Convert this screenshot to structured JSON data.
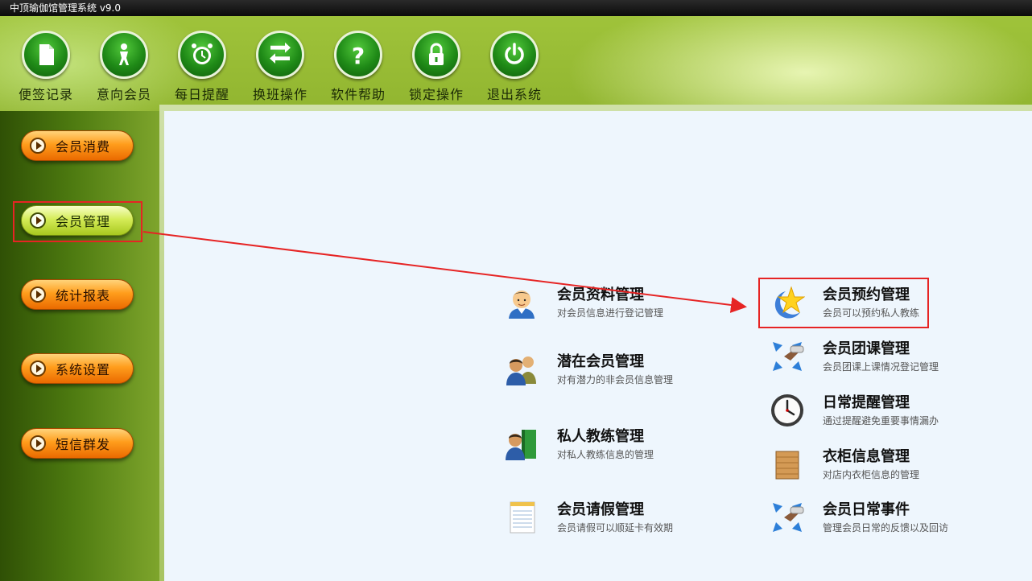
{
  "window": {
    "title": "中顶瑜伽馆管理系统  v9.0"
  },
  "toolbar": [
    {
      "label": "便签记录",
      "icon": "notepad-icon"
    },
    {
      "label": "意向会员",
      "icon": "person-icon"
    },
    {
      "label": "每日提醒",
      "icon": "alarm-clock-icon"
    },
    {
      "label": "换班操作",
      "icon": "swap-arrows-icon"
    },
    {
      "label": "软件帮助",
      "icon": "question-icon"
    },
    {
      "label": "锁定操作",
      "icon": "lock-icon"
    },
    {
      "label": "退出系统",
      "icon": "power-icon"
    }
  ],
  "sidebar": {
    "items": [
      {
        "label": "会员消费"
      },
      {
        "label": "会员管理",
        "active": true
      },
      {
        "label": "统计报表"
      },
      {
        "label": "系统设置"
      },
      {
        "label": "短信群发"
      }
    ]
  },
  "functions": {
    "left": [
      {
        "title": "会员资料管理",
        "desc": "对会员信息进行登记管理",
        "icon": "member-avatar-icon"
      },
      {
        "title": "潜在会员管理",
        "desc": "对有潜力的非会员信息管理",
        "icon": "users-group-icon"
      },
      {
        "title": "私人教练管理",
        "desc": "对私人教练信息的管理",
        "icon": "trainer-book-icon"
      },
      {
        "title": "会员请假管理",
        "desc": "会员请假可以顺延卡有效期",
        "icon": "notepad-lines-icon"
      }
    ],
    "right": [
      {
        "title": "会员预约管理",
        "desc": "会员可以预约私人教练",
        "icon": "star-moon-icon"
      },
      {
        "title": "会员团课管理",
        "desc": "会员团课上课情况登记管理",
        "icon": "arrows-hand-icon"
      },
      {
        "title": "日常提醒管理",
        "desc": "通过提醒避免重要事情漏办",
        "icon": "clock-icon"
      },
      {
        "title": "衣柜信息管理",
        "desc": "对店内衣柜信息的管理",
        "icon": "wooden-cabinet-icon"
      },
      {
        "title": "会员日常事件",
        "desc": "管理会员日常的反馈以及回访",
        "icon": "arrows-hand-icon"
      }
    ]
  },
  "colors": {
    "highlight": "#e62424",
    "accent_green": "#1f8a17",
    "nav_orange": "#ff9d1c",
    "panel_bg": "#eef6fd"
  }
}
